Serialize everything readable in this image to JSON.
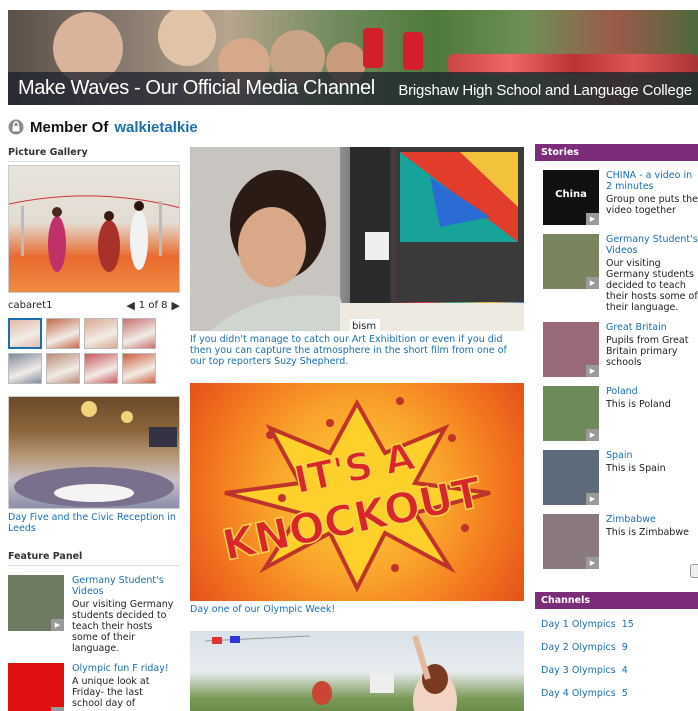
{
  "banner": {
    "title": "Make Waves - Our Official Media Channel",
    "school": "Brigshaw High School and Language College"
  },
  "member": {
    "label": "Member Of",
    "channel": "walkietalkie"
  },
  "gallery": {
    "title": "Picture Gallery",
    "image_name": "cabaret1",
    "pager": "1 of 8",
    "thumb_colors": [
      "#e3b9a8",
      "#c46a4a",
      "#d9a890",
      "#c87070",
      "#7d8a9c",
      "#b98b7a",
      "#c9565a",
      "#d06040"
    ]
  },
  "civic": {
    "caption": "Day Five and the Civic Reception in Leeds"
  },
  "feature_panel": {
    "title": "Feature Panel",
    "items": [
      {
        "title": "Germany Student's Videos",
        "desc": "Our visiting Germany students decided to teach their hosts some of their language.",
        "thumb": "#6f7a62"
      },
      {
        "title": "Olympic fun F riday!",
        "desc": "A unique look at Friday- the last school day of",
        "thumb": "#e01010"
      }
    ]
  },
  "main": {
    "video1_caption": "If you didn't manage to catch our Art Exhibition or even if you did then you can capture the atmosphere in the short film from one of our top reporters Suzy Shepherd.",
    "video1_sign": "bism",
    "video2_text_line1": "IT'S A",
    "video2_text_line2": "KNOCKOUT",
    "video2_caption": "Day one of our Olympic Week!"
  },
  "stories": {
    "title": "Stories",
    "items": [
      {
        "title": "CHINA - a video in 2 minutes",
        "desc": "Group one puts the video together",
        "thumb_label": "China",
        "thumb": "#111111"
      },
      {
        "title": "Germany Student's Videos",
        "desc": "Our visiting Germany students decided to teach their hosts some of their language.",
        "thumb_label": "",
        "thumb": "#7a8560"
      },
      {
        "title": "Great Britain",
        "desc": "Pupils from Great Britain primary schools",
        "thumb_label": "",
        "thumb": "#9a6a78"
      },
      {
        "title": "Poland",
        "desc": "This is Poland",
        "thumb_label": "",
        "thumb": "#6c8a5a"
      },
      {
        "title": "Spain",
        "desc": "This is Spain",
        "thumb_label": "",
        "thumb": "#5d6a7a"
      },
      {
        "title": "Zimbabwe",
        "desc": "This is Zimbabwe",
        "thumb_label": "",
        "thumb": "#8a7a80"
      }
    ]
  },
  "channels": {
    "title": "Channels",
    "items": [
      {
        "name": "Day 1 Olympics",
        "count": "15"
      },
      {
        "name": "Day 2 Olympics",
        "count": "9"
      },
      {
        "name": "Day 3 Olympics",
        "count": "4"
      },
      {
        "name": "Day 4 Olympics",
        "count": "5"
      }
    ]
  },
  "colors": {
    "accent": "#7b2d7a",
    "link": "#1a6fb0"
  }
}
